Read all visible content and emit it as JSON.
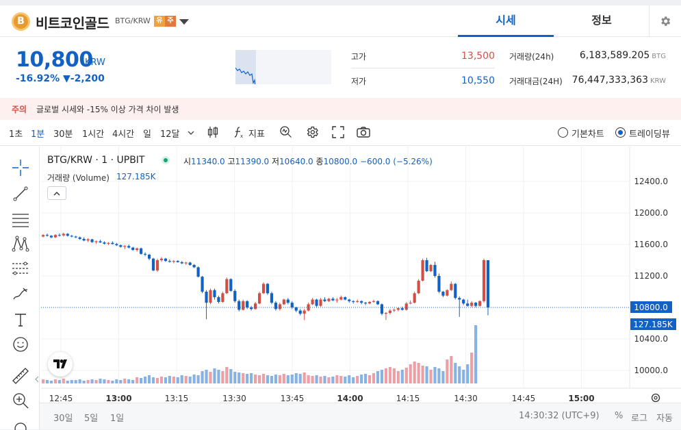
{
  "header": {
    "coin_symbol": "B",
    "coin_name": "비트코인골드",
    "pair": "BTG/KRW",
    "badge_a": "유",
    "badge_b": "주",
    "tab_price": "시세",
    "tab_info": "정보",
    "icons": [
      "bitcoin-icon",
      "chevron-down-icon",
      "gear-icon"
    ]
  },
  "price": {
    "current": "10,800",
    "unit": "KRW",
    "change_pct": "-16.92%",
    "change_amt": "▼-2,200"
  },
  "stats": {
    "high_label": "고가",
    "high_value": "13,500",
    "low_label": "저가",
    "low_value": "10,550",
    "volume_label": "거래량(24h)",
    "volume_value": "6,183,589.205",
    "volume_unit": "BTG",
    "amount_label": "거래대금(24H)",
    "amount_value": "76,447,333,363",
    "amount_unit": "KRW"
  },
  "warning": {
    "tag": "주의",
    "message": "글로벌 시세와 -15% 이상 가격 차이 발생"
  },
  "toolbar": {
    "intervals": [
      "1초",
      "1분",
      "30분",
      "1시간",
      "4시간",
      "일",
      "12달"
    ],
    "active_interval": "1분",
    "indicator_label": "지표",
    "basic_chart": "기본차트",
    "trading_view": "트레이딩뷰",
    "selected_view": "트레이딩뷰"
  },
  "legend": {
    "symbol": "BTG/KRW · 1 · UPBIT",
    "o_label": "시",
    "o_value": "11340.0",
    "h_label": "고",
    "h_value": "11390.0",
    "l_label": "저",
    "l_value": "10640.0",
    "c_label": "종",
    "c_value": "10800.0",
    "change": "−600.0 (−5.26%)",
    "volume_label": "거래량 (Volume)",
    "volume_value": "127.185K"
  },
  "colors": {
    "accent": "#1261c4",
    "up": "#d24f45",
    "down": "#1261c4",
    "vol_up": "#ec9fa5",
    "vol_down": "#87b2e6"
  },
  "chart_data": {
    "type": "candlestick",
    "y_ticks": [
      12400,
      12000,
      11600,
      11200,
      10800,
      10400,
      10000
    ],
    "ylim": [
      9800,
      12600
    ],
    "price_label": "10800.0",
    "volume_label": "127.185K",
    "x_ticks": [
      "12:45",
      "13:00",
      "13:15",
      "13:30",
      "13:45",
      "14:00",
      "14:15",
      "14:30",
      "14:45",
      "15:00"
    ],
    "x_bold": [
      "13:00",
      "14:00",
      "15:00"
    ],
    "candles": [
      [
        11700,
        11730,
        11690,
        11720
      ],
      [
        11720,
        11740,
        11700,
        11710
      ],
      [
        11710,
        11720,
        11680,
        11690
      ],
      [
        11690,
        11730,
        11680,
        11720
      ],
      [
        11720,
        11740,
        11700,
        11715
      ],
      [
        11715,
        11750,
        11700,
        11735
      ],
      [
        11735,
        11745,
        11700,
        11710
      ],
      [
        11710,
        11720,
        11690,
        11700
      ],
      [
        11700,
        11710,
        11680,
        11690
      ],
      [
        11690,
        11700,
        11660,
        11670
      ],
      [
        11670,
        11690,
        11640,
        11650
      ],
      [
        11650,
        11680,
        11630,
        11665
      ],
      [
        11665,
        11670,
        11620,
        11630
      ],
      [
        11630,
        11650,
        11610,
        11640
      ],
      [
        11640,
        11660,
        11620,
        11625
      ],
      [
        11625,
        11640,
        11600,
        11610
      ],
      [
        11610,
        11630,
        11590,
        11620
      ],
      [
        11620,
        11640,
        11600,
        11605
      ],
      [
        11605,
        11620,
        11580,
        11590
      ],
      [
        11590,
        11600,
        11560,
        11570
      ],
      [
        11570,
        11590,
        11540,
        11580
      ],
      [
        11580,
        11600,
        11550,
        11560
      ],
      [
        11560,
        11570,
        11520,
        11530
      ],
      [
        11530,
        11560,
        11510,
        11550
      ],
      [
        11550,
        11560,
        11470,
        11480
      ],
      [
        11480,
        11500,
        11450,
        11470
      ],
      [
        11470,
        11480,
        11400,
        11420
      ],
      [
        11420,
        11430,
        11260,
        11270
      ],
      [
        11270,
        11420,
        11250,
        11400
      ],
      [
        11400,
        11440,
        11380,
        11420
      ],
      [
        11420,
        11430,
        11380,
        11390
      ],
      [
        11390,
        11410,
        11370,
        11380
      ],
      [
        11380,
        11400,
        11360,
        11390
      ],
      [
        11390,
        11400,
        11370,
        11375
      ],
      [
        11375,
        11390,
        11350,
        11360
      ],
      [
        11360,
        11380,
        11340,
        11370
      ],
      [
        11370,
        11380,
        11330,
        11340
      ],
      [
        11340,
        11350,
        11300,
        11310
      ],
      [
        11310,
        11320,
        11180,
        11190
      ],
      [
        11190,
        11200,
        10980,
        11000
      ],
      [
        11000,
        11020,
        10650,
        10860
      ],
      [
        10860,
        11040,
        10840,
        11020
      ],
      [
        11020,
        11040,
        10900,
        10930
      ],
      [
        10930,
        10950,
        10850,
        10870
      ],
      [
        10870,
        11000,
        10860,
        10980
      ],
      [
        10980,
        11180,
        10970,
        11160
      ],
      [
        11160,
        11170,
        11000,
        11010
      ],
      [
        11010,
        11030,
        10860,
        10880
      ],
      [
        10880,
        10900,
        10750,
        10770
      ],
      [
        10770,
        10900,
        10760,
        10880
      ],
      [
        10880,
        10890,
        10780,
        10800
      ],
      [
        10800,
        10820,
        10760,
        10780
      ],
      [
        10780,
        10870,
        10770,
        10850
      ],
      [
        10850,
        11000,
        10840,
        10980
      ],
      [
        10980,
        11120,
        10970,
        11100
      ],
      [
        11100,
        11110,
        10960,
        10980
      ],
      [
        10980,
        11000,
        10840,
        10860
      ],
      [
        10860,
        10880,
        10760,
        10780
      ],
      [
        10780,
        10860,
        10760,
        10840
      ],
      [
        10840,
        10910,
        10830,
        10900
      ],
      [
        10900,
        10920,
        10840,
        10860
      ],
      [
        10860,
        10880,
        10780,
        10800
      ],
      [
        10800,
        10810,
        10740,
        10760
      ],
      [
        10760,
        10780,
        10700,
        10720
      ],
      [
        10720,
        10780,
        10640,
        10760
      ],
      [
        10760,
        10860,
        10750,
        10840
      ],
      [
        10840,
        10920,
        10830,
        10900
      ],
      [
        10900,
        10910,
        10800,
        10820
      ],
      [
        10820,
        10920,
        10810,
        10900
      ],
      [
        10900,
        10930,
        10870,
        10880
      ],
      [
        10880,
        10920,
        10870,
        10910
      ],
      [
        10910,
        10930,
        10880,
        10890
      ],
      [
        10890,
        10920,
        10860,
        10900
      ],
      [
        10900,
        10950,
        10890,
        10930
      ],
      [
        10930,
        10940,
        10890,
        10900
      ],
      [
        10900,
        10910,
        10860,
        10880
      ],
      [
        10880,
        10890,
        10850,
        10870
      ],
      [
        10870,
        10900,
        10860,
        10880
      ],
      [
        10880,
        10890,
        10840,
        10860
      ],
      [
        10860,
        10870,
        10830,
        10850
      ],
      [
        10850,
        10880,
        10840,
        10870
      ],
      [
        10870,
        10900,
        10860,
        10880
      ],
      [
        10880,
        10890,
        10830,
        10840
      ],
      [
        10840,
        10850,
        10700,
        10720
      ],
      [
        10720,
        10740,
        10640,
        10730
      ],
      [
        10730,
        10780,
        10710,
        10760
      ],
      [
        10760,
        10790,
        10740,
        10770
      ],
      [
        10770,
        10800,
        10750,
        10790
      ],
      [
        10790,
        10810,
        10760,
        10770
      ],
      [
        10770,
        10870,
        10760,
        10850
      ],
      [
        10850,
        10890,
        10840,
        10860
      ],
      [
        10860,
        11000,
        10850,
        10980
      ],
      [
        10980,
        11160,
        10970,
        11140
      ],
      [
        11140,
        11420,
        11130,
        11400
      ],
      [
        11400,
        11430,
        11250,
        11260
      ],
      [
        11260,
        11350,
        11250,
        11340
      ],
      [
        11340,
        11380,
        11180,
        11200
      ],
      [
        11200,
        11230,
        10980,
        11000
      ],
      [
        11000,
        11010,
        10930,
        10950
      ],
      [
        10950,
        11030,
        10940,
        11020
      ],
      [
        11020,
        11130,
        11010,
        11100
      ],
      [
        11100,
        11110,
        10900,
        10920
      ],
      [
        10920,
        10940,
        10680,
        10900
      ],
      [
        10900,
        10910,
        10830,
        10850
      ],
      [
        10850,
        10900,
        10810,
        10820
      ],
      [
        10820,
        10880,
        10800,
        10860
      ],
      [
        10860,
        10870,
        10800,
        10820
      ],
      [
        10820,
        10890,
        10810,
        10880
      ],
      [
        10880,
        11420,
        10860,
        11400
      ],
      [
        11400,
        11380,
        10700,
        10800
      ]
    ],
    "volumes": [
      6,
      5,
      4,
      6,
      5,
      7,
      4,
      5,
      5,
      6,
      4,
      5,
      6,
      5,
      7,
      6,
      5,
      4,
      6,
      5,
      7,
      6,
      5,
      9,
      8,
      10,
      12,
      9,
      8,
      10,
      9,
      11,
      10,
      9,
      12,
      11,
      10,
      13,
      12,
      18,
      20,
      17,
      22,
      20,
      18,
      24,
      21,
      17,
      16,
      15,
      14,
      15,
      13,
      12,
      14,
      12,
      11,
      13,
      12,
      14,
      12,
      13,
      15,
      14,
      16,
      12,
      11,
      12,
      10,
      11,
      9,
      10,
      12,
      11,
      10,
      12,
      9,
      11,
      13,
      14,
      12,
      15,
      18,
      20,
      22,
      24,
      22,
      18,
      20,
      23,
      28,
      32,
      30,
      26,
      25,
      20,
      24,
      22,
      18,
      35,
      40,
      30,
      25,
      20,
      28,
      45,
      85
    ]
  }
}
